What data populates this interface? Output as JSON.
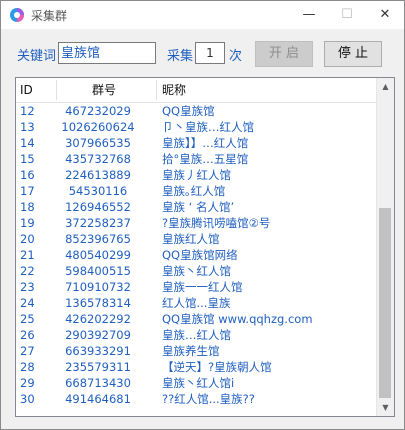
{
  "window": {
    "title": "采集群",
    "min_glyph": "—",
    "max_glyph": "☐",
    "close_glyph": "✕"
  },
  "form": {
    "keyword_label": "关键词",
    "keyword_value": "皇族馆",
    "collect_label": "采集",
    "count_value": "1",
    "times_label": "次",
    "start_label": "开 启",
    "stop_label": "停 止"
  },
  "table": {
    "headers": [
      "ID",
      "群号",
      "昵称"
    ],
    "rows": [
      {
        "id": "12",
        "num": "467232029",
        "nick": "QQ皇族馆"
      },
      {
        "id": "13",
        "num": "1026260624",
        "nick": "卩丶皇族…红人馆"
      },
      {
        "id": "14",
        "num": "307966535",
        "nick": "皇族】】…红人馆"
      },
      {
        "id": "15",
        "num": "435732768",
        "nick": "拾°皇族…五星馆"
      },
      {
        "id": "16",
        "num": "224613889",
        "nick": "皇族丿红人馆"
      },
      {
        "id": "17",
        "num": "54530116",
        "nick": "皇族｡红人馆"
      },
      {
        "id": "18",
        "num": "126946552",
        "nick": "皇族 ‘  名人馆’"
      },
      {
        "id": "19",
        "num": "372258237",
        "nick": "?皇族腾讯唠嗑馆②号"
      },
      {
        "id": "20",
        "num": "852396765",
        "nick": "皇族红人馆"
      },
      {
        "id": "21",
        "num": "480540299",
        "nick": "QQ皇族馆网络"
      },
      {
        "id": "22",
        "num": "598400515",
        "nick": "皇族丶红人馆"
      },
      {
        "id": "23",
        "num": "710910732",
        "nick": "皇族一一红人馆"
      },
      {
        "id": "24",
        "num": "136578314",
        "nick": "红人馆...皇族"
      },
      {
        "id": "25",
        "num": "426202292",
        "nick": "QQ皇族馆 www.qqhzg.com"
      },
      {
        "id": "26",
        "num": "290392709",
        "nick": "皇族…红人馆"
      },
      {
        "id": "27",
        "num": "663933291",
        "nick": "皇族养生馆"
      },
      {
        "id": "28",
        "num": "235579311",
        "nick": "【逆天】?皇族朝人馆"
      },
      {
        "id": "29",
        "num": "668713430",
        "nick": "皇族丶红人馆i"
      },
      {
        "id": "30",
        "num": "491464681",
        "nick": "??红人馆...皇族??"
      }
    ]
  },
  "scrollbar": {
    "up_glyph": "▲",
    "down_glyph": "▼"
  },
  "colors": {
    "text_blue": "#1f5fbf",
    "accent": "#00a0e9"
  }
}
